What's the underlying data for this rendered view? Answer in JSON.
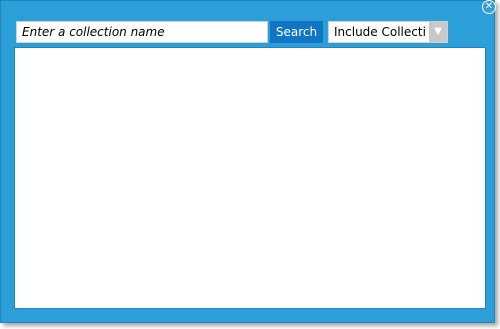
{
  "search": {
    "placeholder": "Enter a collection name",
    "button_label": "Search"
  },
  "filter": {
    "selected": "Include Collectio"
  },
  "icons": {
    "close": "close-icon",
    "dropdown": "chevron-down-icon"
  },
  "colors": {
    "frame": "#2c9fd9",
    "button": "#1076c4",
    "arrow_bg": "#c8c8c8"
  }
}
